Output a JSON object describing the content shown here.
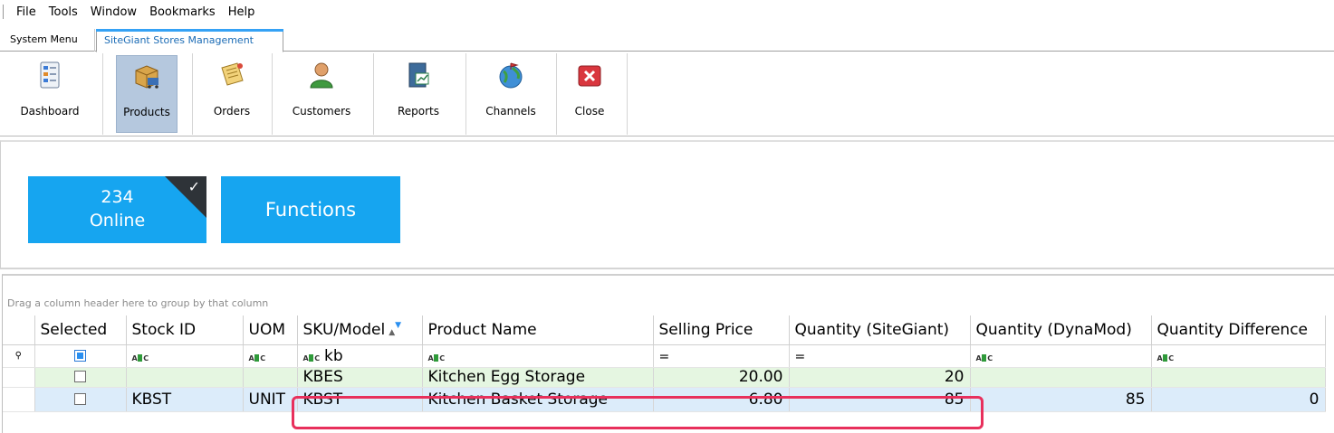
{
  "menu": [
    "File",
    "Tools",
    "Window",
    "Bookmarks",
    "Help"
  ],
  "tabs": {
    "system_menu": "System Menu",
    "stores": "SiteGiant Stores Management"
  },
  "ribbon": {
    "dashboard": "Dashboard",
    "products": "Products",
    "orders": "Orders",
    "customers": "Customers",
    "reports": "Reports",
    "channels": "Channels",
    "close": "Close"
  },
  "tiles": {
    "online_count": "234",
    "online_label": "Online",
    "functions": "Functions"
  },
  "grid": {
    "group_hint": "Drag a column header here to group by that column",
    "columns": [
      "Selected",
      "Stock ID",
      "UOM",
      "SKU/Model",
      "Product Name",
      "Selling Price",
      "Quantity (SiteGiant)",
      "Quantity (DynaMod)",
      "Quantity Difference"
    ],
    "filter_sku": "kb",
    "rows": [
      {
        "stock_id": "",
        "uom": "",
        "sku": "KBES",
        "name": "Kitchen Egg Storage",
        "price": "20.00",
        "qty_sg": "20",
        "qty_dm": "",
        "qty_diff": ""
      },
      {
        "stock_id": "KBST",
        "uom": "UNIT",
        "sku": "KBST",
        "name": "Kitchen Basket Storage",
        "price": "6.80",
        "qty_sg": "85",
        "qty_dm": "85",
        "qty_diff": "0"
      }
    ]
  },
  "colors": {
    "tile": "#16a5f0",
    "highlight": "#e8305c",
    "row_green": "#e5f6e1",
    "row_blue": "#dcecfa"
  }
}
